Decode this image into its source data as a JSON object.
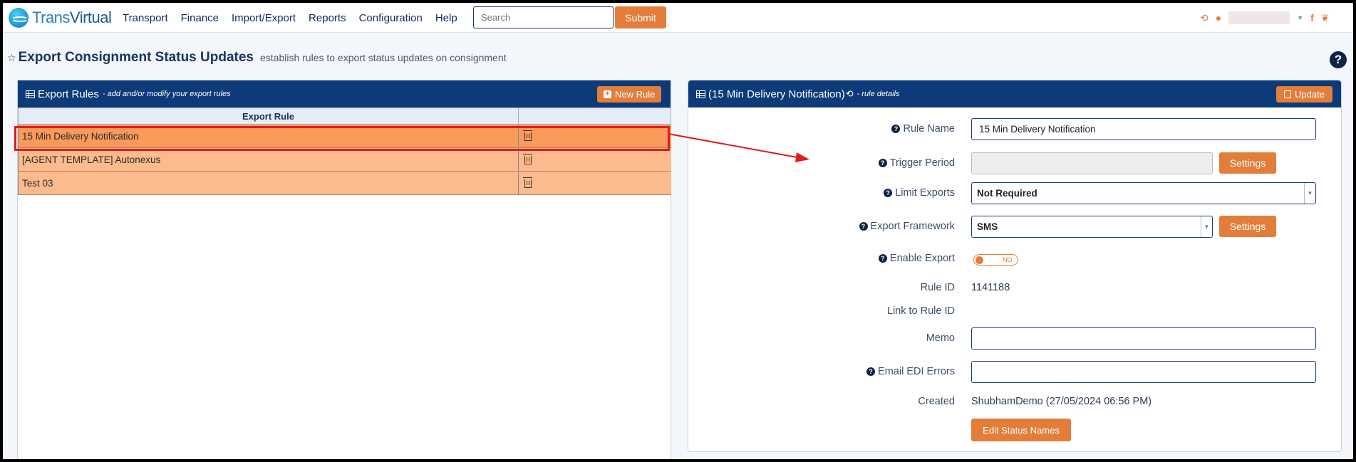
{
  "app": {
    "logo_prefix": "Trans",
    "logo_suffix": "Virtual"
  },
  "nav": {
    "items": [
      "Transport",
      "Finance",
      "Import/Export",
      "Reports",
      "Configuration",
      "Help"
    ],
    "search_placeholder": "Search",
    "submit_label": "Submit"
  },
  "page": {
    "title": "Export Consignment Status Updates",
    "subtitle": "establish rules to export status updates on consignment"
  },
  "left_panel": {
    "title": "Export Rules",
    "subtitle": "- add and/or modify your export rules",
    "new_rule_label": "New Rule",
    "column_header": "Export Rule",
    "rows": [
      {
        "name": "15 Min Delivery Notification",
        "selected": true
      },
      {
        "name": "[AGENT TEMPLATE] Autonexus",
        "selected": false
      },
      {
        "name": "Test 03",
        "selected": false
      }
    ]
  },
  "right_panel": {
    "title": "(15 Min Delivery Notification)",
    "subtitle": "- rule details",
    "update_label": "Update",
    "fields": {
      "rule_name_label": "Rule Name",
      "rule_name_value": "15 Min Delivery Notification",
      "trigger_period_label": "Trigger Period",
      "trigger_period_value": "",
      "settings_label": "Settings",
      "limit_exports_label": "Limit Exports",
      "limit_exports_value": "Not Required",
      "export_framework_label": "Export Framework",
      "export_framework_value": "SMS",
      "enable_export_label": "Enable Export",
      "enable_export_state": "NO",
      "rule_id_label": "Rule ID",
      "rule_id_value": "1141188",
      "link_rule_id_label": "Link to Rule ID",
      "memo_label": "Memo",
      "memo_value": "",
      "email_edi_label": "Email EDI Errors",
      "email_edi_value": "",
      "created_label": "Created",
      "created_value": "ShubhamDemo (27/05/2024 06:56 PM)",
      "edit_status_label": "Edit Status Names"
    }
  },
  "colors": {
    "navy": "#0d3a78",
    "orange": "#e27d3a",
    "row_selected": "#f99a5b",
    "row_normal": "#fdbb8d",
    "annotation_red": "#e01b1b"
  }
}
